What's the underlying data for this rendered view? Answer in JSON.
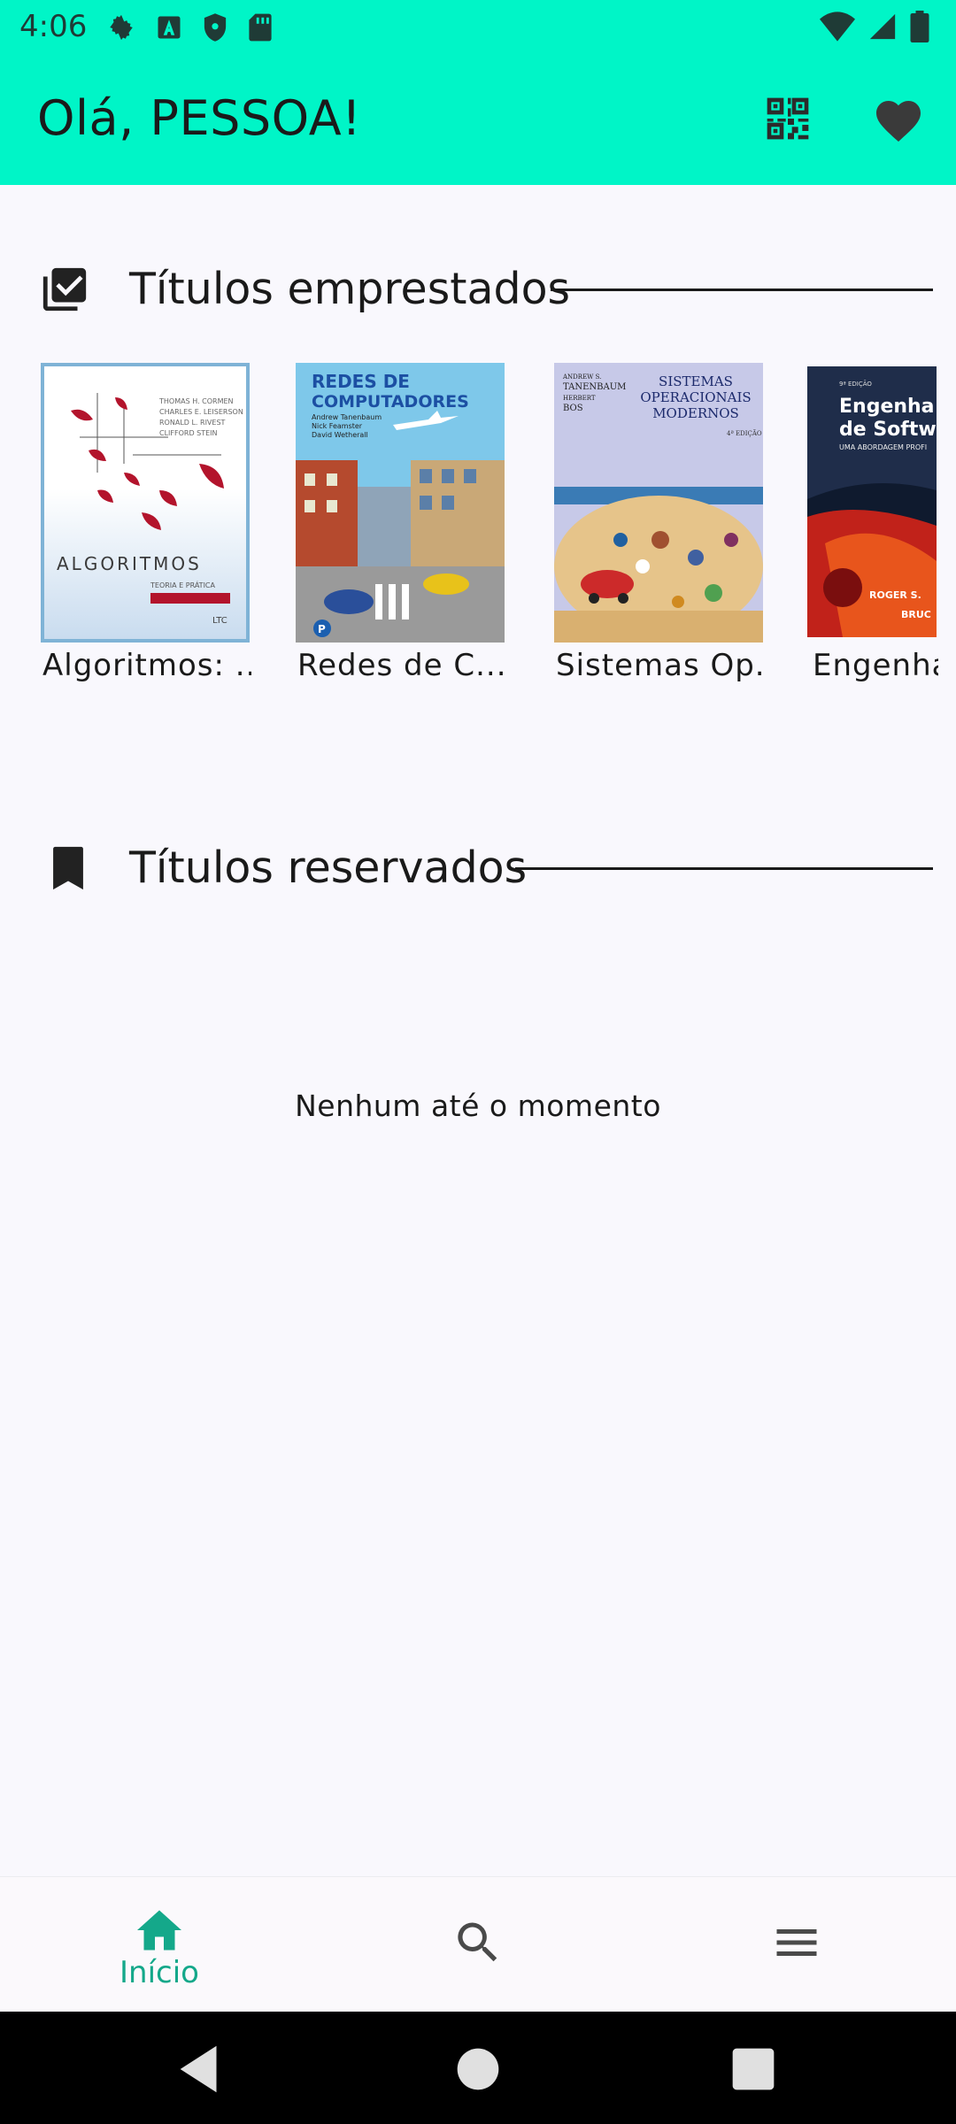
{
  "status_bar": {
    "time": "4:06",
    "left_icons": [
      "gear-icon",
      "text-a-icon",
      "shield-icon",
      "sd-card-icon"
    ],
    "right_icons": [
      "wifi-icon",
      "signal-icon",
      "battery-icon"
    ]
  },
  "app_bar": {
    "title": "Olá, PESSOA!",
    "actions": [
      "qr-code-icon",
      "heart-icon"
    ]
  },
  "sections": {
    "borrowed": {
      "title": "Títulos emprestados",
      "icon": "library-check-icon",
      "books": [
        {
          "title": "Algoritmos: ...",
          "cover_title": "ALGORITMOS"
        },
        {
          "title": "Redes de C...",
          "cover_title": "REDES DE COMPUTADORES"
        },
        {
          "title": "Sistemas Op...",
          "cover_title": "SISTEMAS OPERACIONAIS MODERNOS"
        },
        {
          "title": "Engenha",
          "cover_title": "Engenha de Softw"
        }
      ]
    },
    "reserved": {
      "title": "Títulos reservados",
      "icon": "bookmark-icon",
      "empty_text": "Nenhum até o momento"
    }
  },
  "bottom_nav": {
    "items": [
      {
        "label": "Início",
        "icon": "home-icon",
        "active": true
      },
      {
        "label": "",
        "icon": "search-icon",
        "active": false
      },
      {
        "label": "",
        "icon": "menu-icon",
        "active": false
      }
    ]
  },
  "colors": {
    "accent": "#00f5c7",
    "active_nav": "#14a88a",
    "background": "#f9f8fd"
  }
}
